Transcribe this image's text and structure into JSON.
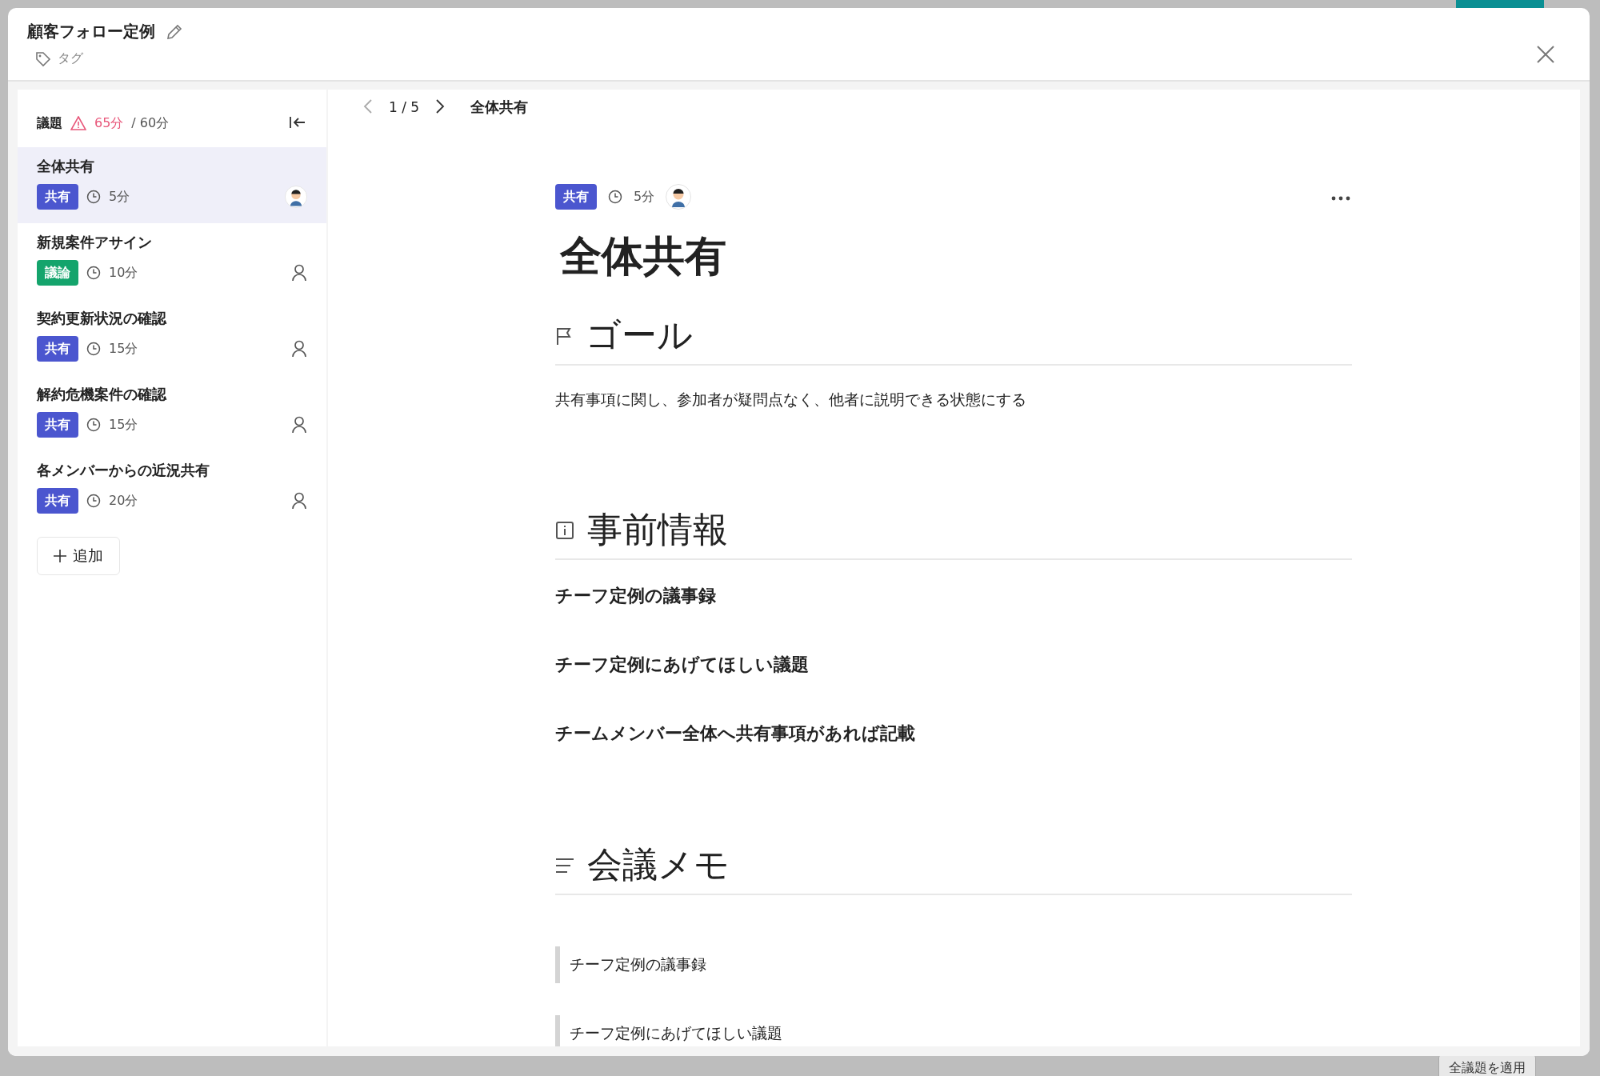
{
  "modal": {
    "title": "顧客フォロー定例",
    "tag_placeholder": "タグ"
  },
  "agenda": {
    "label": "議題",
    "total": "65分",
    "over": true,
    "limit": "/ 60分",
    "items": [
      {
        "title": "全体共有",
        "category": {
          "label": "共有",
          "color": "#4b56cf"
        },
        "duration": "5分",
        "assignee": {
          "kind": "avatar"
        },
        "selected": true
      },
      {
        "title": "新規案件アサイン",
        "category": {
          "label": "議論",
          "color": "#14a46c"
        },
        "duration": "10分",
        "assignee": {
          "kind": "none"
        },
        "selected": false
      },
      {
        "title": "契約更新状況の確認",
        "category": {
          "label": "共有",
          "color": "#4b56cf"
        },
        "duration": "15分",
        "assignee": {
          "kind": "none"
        },
        "selected": false
      },
      {
        "title": "解約危機案件の確認",
        "category": {
          "label": "共有",
          "color": "#4b56cf"
        },
        "duration": "15分",
        "assignee": {
          "kind": "none"
        },
        "selected": false
      },
      {
        "title": "各メンバーからの近況共有",
        "category": {
          "label": "共有",
          "color": "#4b56cf"
        },
        "duration": "20分",
        "assignee": {
          "kind": "none"
        },
        "selected": false
      }
    ],
    "add_button": "追加"
  },
  "pager": {
    "position": "1 / 5",
    "title": "全体共有"
  },
  "topic": {
    "category": {
      "label": "共有",
      "color": "#4b56cf"
    },
    "duration": "5分",
    "assignee": {
      "kind": "avatar"
    },
    "title": "全体共有",
    "sections": [
      {
        "kind": "flag",
        "heading": "ゴール",
        "blocks": [
          {
            "kind": "paragraph",
            "text": "共有事項に関し、参加者が疑問点なく、他者に説明できる状態にする"
          }
        ]
      },
      {
        "kind": "info",
        "heading": "事前情報",
        "blocks": [
          {
            "kind": "bold",
            "text": "チーフ定例の議事録"
          },
          {
            "kind": "bold",
            "text": "チーフ定例にあげてほしい議題"
          },
          {
            "kind": "bold",
            "text": "チームメンバー全体へ共有事項があれば記載"
          }
        ]
      },
      {
        "kind": "lines",
        "heading": "会議メモ",
        "blocks": [
          {
            "kind": "quote",
            "text": "チーフ定例の議事録"
          },
          {
            "kind": "quote",
            "text": "チーフ定例にあげてほしい議題"
          }
        ]
      }
    ]
  },
  "background": {
    "apply_button": "全議題を適用"
  }
}
